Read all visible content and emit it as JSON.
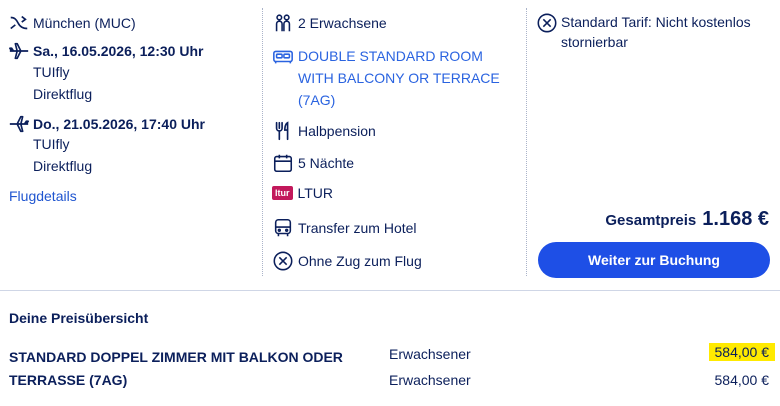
{
  "flight": {
    "origin": "München (MUC)",
    "outbound_date": "Sa., 16.05.2026, 12:30 Uhr",
    "outbound_airline": "TUIfly",
    "outbound_type": "Direktflug",
    "return_date": "Do., 21.05.2026, 17:40 Uhr",
    "return_airline": "TUIfly",
    "return_type": "Direktflug",
    "details_link": "Flugdetails"
  },
  "hotel": {
    "travellers": "2 Erwachsene",
    "room_line1": "DOUBLE STANDARD ROOM",
    "room_line2": "WITH BALCONY OR TERRACE",
    "room_line3": "(7AG)",
    "board": "Halbpension",
    "nights": "5 Nächte",
    "operator_logo": "ltur",
    "operator": "LTUR",
    "transfer": "Transfer zum Hotel",
    "train": "Ohne Zug zum Flug"
  },
  "tariff": {
    "line1": "Standard Tarif: Nicht kostenlos",
    "line2": "stornierbar"
  },
  "total": {
    "label": "Gesamtpreis",
    "value": "1.168 €",
    "button": "Weiter zur Buchung"
  },
  "price_overview": {
    "title": "Deine Preisübersicht",
    "room_line1": "STANDARD DOPPEL ZIMMER MIT BALKON ODER",
    "room_line2": "TERRASSE (7AG)",
    "rows": [
      {
        "type": "Erwachsener",
        "price": "584,00 €"
      },
      {
        "type": "Erwachsener",
        "price": "584,00 €"
      }
    ]
  },
  "colors": {
    "primary_text": "#0b1f5b",
    "link": "#1f55d0",
    "button": "#1e4fe6",
    "highlight": "#ffea00",
    "ltur_logo": "#c2185b"
  }
}
